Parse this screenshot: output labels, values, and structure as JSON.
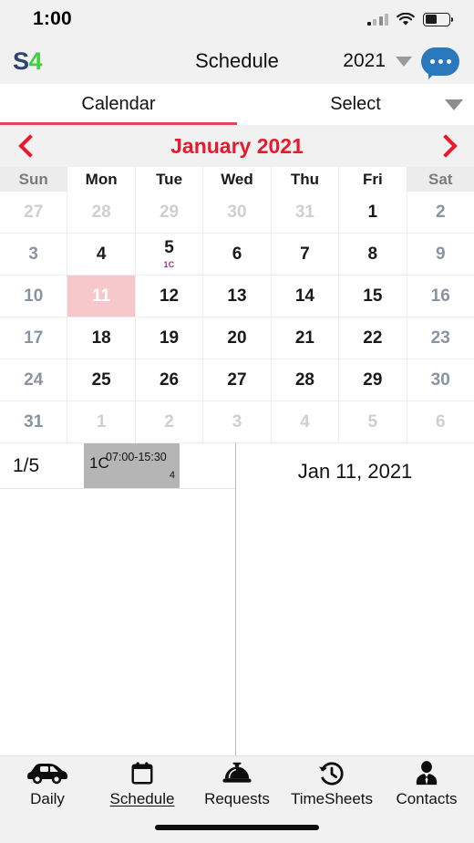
{
  "status_bar": {
    "time": "1:00",
    "signal_icon": "cellular-signal-icon",
    "wifi_icon": "wifi-icon",
    "battery_icon": "battery-icon"
  },
  "nav_bar": {
    "brand_s": "S",
    "brand_4": "4",
    "title": "Schedule",
    "year": "2021",
    "year_caret_icon": "chevron-down-icon",
    "messages_icon": "message-bubble-icon"
  },
  "segments": {
    "calendar_label": "Calendar",
    "select_label": "Select",
    "select_caret_icon": "chevron-down-icon",
    "active": "Calendar",
    "accent": "#e8455a"
  },
  "month_bar": {
    "prev_icon": "chevron-left-icon",
    "next_icon": "chevron-right-icon",
    "title": "January 2021",
    "color": "#e8192c"
  },
  "calendar": {
    "weekday_headers": [
      "Sun",
      "Mon",
      "Tue",
      "Wed",
      "Thu",
      "Fri",
      "Sat"
    ],
    "selected_day": "11",
    "selected_bg": "#f6c8cc",
    "tag_color": "#a0309a",
    "weeks": [
      [
        {
          "d": "27",
          "dim": true,
          "weekend": true
        },
        {
          "d": "28",
          "dim": true,
          "weekend": false
        },
        {
          "d": "29",
          "dim": true,
          "weekend": false
        },
        {
          "d": "30",
          "dim": true,
          "weekend": false
        },
        {
          "d": "31",
          "dim": true,
          "weekend": false
        },
        {
          "d": "1",
          "dim": false,
          "weekend": false
        },
        {
          "d": "2",
          "dim": false,
          "weekend": true
        }
      ],
      [
        {
          "d": "3",
          "dim": false,
          "weekend": true
        },
        {
          "d": "4",
          "dim": false,
          "weekend": false
        },
        {
          "d": "5",
          "dim": false,
          "weekend": false,
          "tag": "1C"
        },
        {
          "d": "6",
          "dim": false,
          "weekend": false
        },
        {
          "d": "7",
          "dim": false,
          "weekend": false
        },
        {
          "d": "8",
          "dim": false,
          "weekend": false
        },
        {
          "d": "9",
          "dim": false,
          "weekend": true
        }
      ],
      [
        {
          "d": "10",
          "dim": false,
          "weekend": true
        },
        {
          "d": "11",
          "dim": false,
          "weekend": false,
          "selected": true
        },
        {
          "d": "12",
          "dim": false,
          "weekend": false
        },
        {
          "d": "13",
          "dim": false,
          "weekend": false
        },
        {
          "d": "14",
          "dim": false,
          "weekend": false
        },
        {
          "d": "15",
          "dim": false,
          "weekend": false
        },
        {
          "d": "16",
          "dim": false,
          "weekend": true
        }
      ],
      [
        {
          "d": "17",
          "dim": false,
          "weekend": true
        },
        {
          "d": "18",
          "dim": false,
          "weekend": false
        },
        {
          "d": "19",
          "dim": false,
          "weekend": false
        },
        {
          "d": "20",
          "dim": false,
          "weekend": false
        },
        {
          "d": "21",
          "dim": false,
          "weekend": false
        },
        {
          "d": "22",
          "dim": false,
          "weekend": false
        },
        {
          "d": "23",
          "dim": false,
          "weekend": true
        }
      ],
      [
        {
          "d": "24",
          "dim": false,
          "weekend": true
        },
        {
          "d": "25",
          "dim": false,
          "weekend": false
        },
        {
          "d": "26",
          "dim": false,
          "weekend": false
        },
        {
          "d": "27",
          "dim": false,
          "weekend": false
        },
        {
          "d": "28",
          "dim": false,
          "weekend": false
        },
        {
          "d": "29",
          "dim": false,
          "weekend": false
        },
        {
          "d": "30",
          "dim": false,
          "weekend": true
        }
      ],
      [
        {
          "d": "31",
          "dim": false,
          "weekend": true
        },
        {
          "d": "1",
          "dim": true,
          "weekend": false
        },
        {
          "d": "2",
          "dim": true,
          "weekend": false
        },
        {
          "d": "3",
          "dim": true,
          "weekend": false
        },
        {
          "d": "4",
          "dim": true,
          "weekend": false
        },
        {
          "d": "5",
          "dim": true,
          "weekend": false
        },
        {
          "d": "6",
          "dim": true,
          "weekend": true
        }
      ]
    ]
  },
  "detail": {
    "row_label": "1/5",
    "event": {
      "code": "1C",
      "time_range": "07:00-15:30",
      "count": "4",
      "bg": "#b5b5b5"
    },
    "selected_date": "Jan 11, 2021"
  },
  "tab_bar": {
    "active": "Schedule",
    "items": [
      {
        "label": "Daily",
        "icon": "car-icon"
      },
      {
        "label": "Schedule",
        "icon": "calendar-icon"
      },
      {
        "label": "Requests",
        "icon": "service-bell-icon"
      },
      {
        "label": "TimeSheets",
        "icon": "clock-history-icon"
      },
      {
        "label": "Contacts",
        "icon": "person-tie-icon"
      }
    ]
  }
}
